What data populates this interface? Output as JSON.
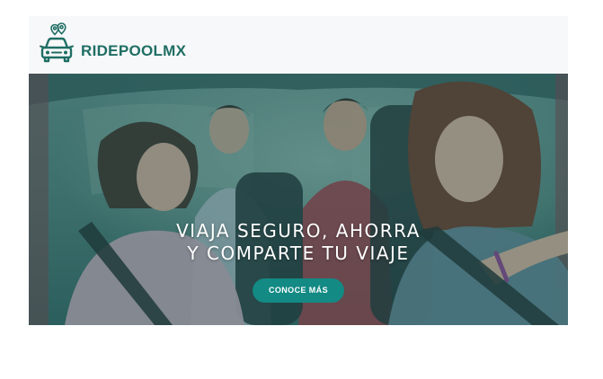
{
  "header": {
    "brand_name": "RIDEPOOLMX",
    "logo_icon": "car-with-location-pins-icon"
  },
  "hero": {
    "headline_line1": "VIAJA SEGURO, AHORRA",
    "headline_line2": "Y COMPARTE TU VIAJE",
    "cta_label": "CONOCE MÁS",
    "image": "photo-of-friends-carpooling-in-car"
  },
  "colors": {
    "brand": "#1f6e64",
    "accent": "#138a84",
    "overlay": "#2f6a68"
  }
}
